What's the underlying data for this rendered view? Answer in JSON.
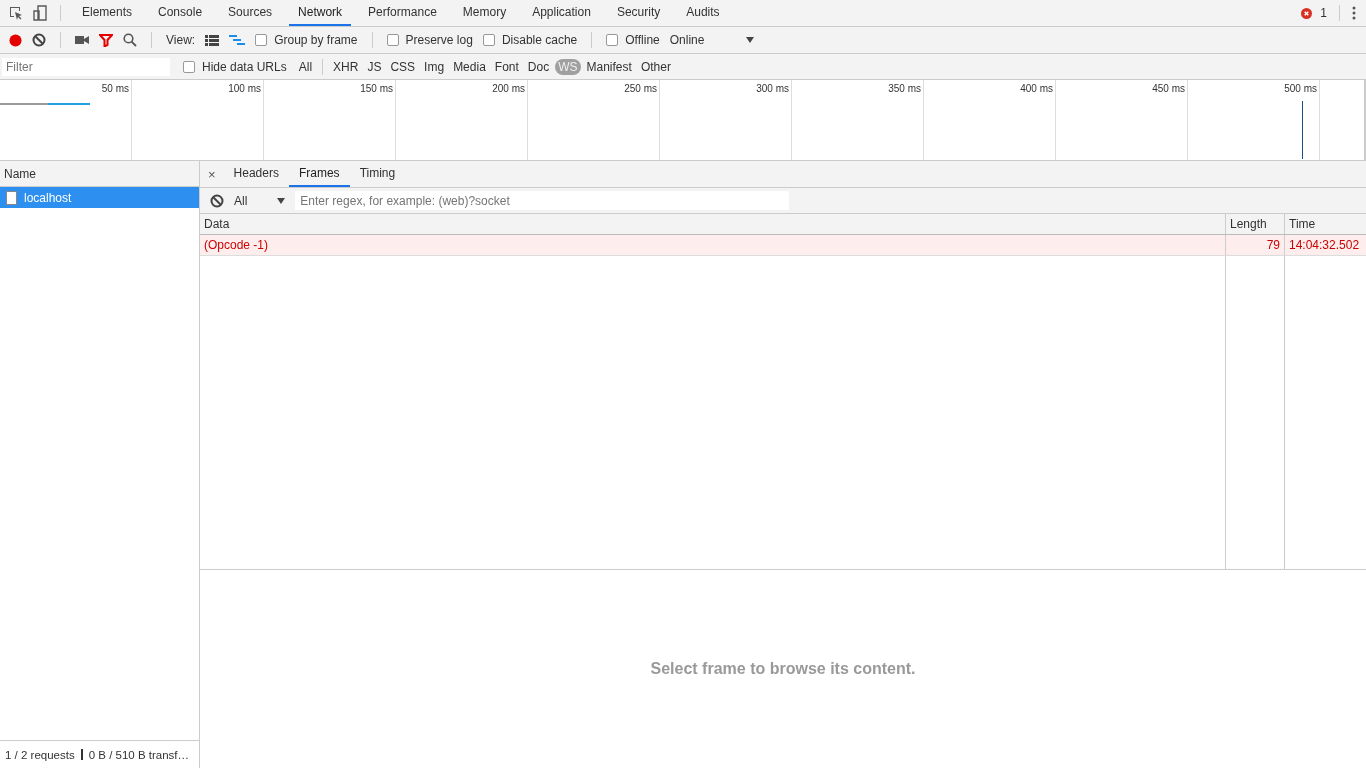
{
  "main_tabs": [
    {
      "label": "Elements",
      "selected": false
    },
    {
      "label": "Console",
      "selected": false
    },
    {
      "label": "Sources",
      "selected": false
    },
    {
      "label": "Network",
      "selected": true
    },
    {
      "label": "Performance",
      "selected": false
    },
    {
      "label": "Memory",
      "selected": false
    },
    {
      "label": "Application",
      "selected": false
    },
    {
      "label": "Security",
      "selected": false
    },
    {
      "label": "Audits",
      "selected": false
    }
  ],
  "error_count": "1",
  "toolbar": {
    "recording": true,
    "filter_on": true,
    "view_label": "View:",
    "view_modes": [
      {
        "kind": "list",
        "selected": false
      },
      {
        "kind": "waterfall",
        "selected": true
      }
    ],
    "checkboxes": [
      {
        "label": "Group by frame",
        "checked": false
      },
      {
        "label": "Preserve log",
        "checked": false
      },
      {
        "label": "Disable cache",
        "checked": false
      },
      {
        "label": "Offline",
        "checked": false
      }
    ],
    "throttling": "Online"
  },
  "filter_bar": {
    "placeholder": "Filter",
    "hide_data_urls": {
      "label": "Hide data URLs",
      "checked": false
    },
    "types": [
      {
        "label": "All",
        "selected": false
      },
      {
        "label": "XHR",
        "selected": false
      },
      {
        "label": "JS",
        "selected": false
      },
      {
        "label": "CSS",
        "selected": false
      },
      {
        "label": "Img",
        "selected": false
      },
      {
        "label": "Media",
        "selected": false
      },
      {
        "label": "Font",
        "selected": false
      },
      {
        "label": "Doc",
        "selected": false
      },
      {
        "label": "WS",
        "selected": true
      },
      {
        "label": "Manifest",
        "selected": false
      },
      {
        "label": "Other",
        "selected": false
      }
    ]
  },
  "overview": {
    "ticks": [
      "50 ms",
      "100 ms",
      "150 ms",
      "200 ms",
      "250 ms",
      "300 ms",
      "350 ms",
      "400 ms",
      "450 ms",
      "500 ms"
    ]
  },
  "requests": {
    "column": "Name",
    "rows": [
      {
        "name": "localhost",
        "selected": true
      }
    ]
  },
  "detail": {
    "close": "×",
    "tabs": [
      {
        "label": "Headers",
        "selected": false
      },
      {
        "label": "Frames",
        "selected": true
      },
      {
        "label": "Timing",
        "selected": false
      }
    ],
    "frame_filter": {
      "type": "All",
      "placeholder": "Enter regex, for example: (web)?socket"
    },
    "columns": [
      "Data",
      "Length",
      "Time"
    ],
    "frames": [
      {
        "data": "(Opcode -1)",
        "length": "79",
        "time": "14:04:32.502",
        "error": true
      }
    ],
    "empty_message": "Select frame to browse its content."
  },
  "status": {
    "requests": "1 / 2 requests",
    "transferred": "0 B / 510 B transf…"
  }
}
